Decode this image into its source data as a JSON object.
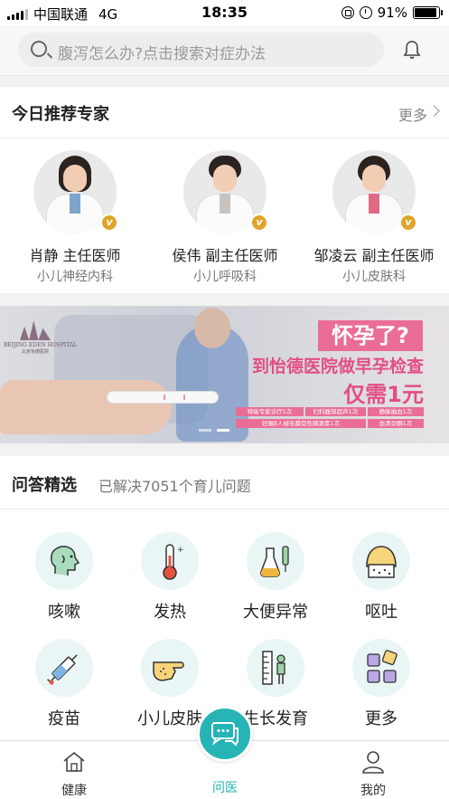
{
  "status_bar": {
    "carrier": "中国联通",
    "network": "4G",
    "time": "18:35",
    "battery": "91%"
  },
  "search": {
    "placeholder": "腹泻怎么办?点击搜索对症办法",
    "icon": "search-icon",
    "bell_icon": "bell-icon"
  },
  "experts": {
    "title": "今日推荐专家",
    "more": "更多",
    "badge": "v",
    "items": [
      {
        "name": "肖静 主任医师",
        "dept": "小儿神经内科"
      },
      {
        "name": "侯伟 副主任医师",
        "dept": "小儿呼吸科"
      },
      {
        "name": "邹凌云 副主任医师",
        "dept": "小儿皮肤科"
      }
    ]
  },
  "banner": {
    "logo_text": "BEIJING EDEN HOSPITAL",
    "logo_sub": "北京怡德医院",
    "headline": "怀孕了?",
    "line2": "到怡德医院做早孕检查",
    "line3": "仅需1元",
    "tags": [
      "特级专家诊疗1次",
      "妇科腹部超声1次",
      "静脉抽血1次",
      "妊娠β人绒毛膜促性腺激素1次",
      "血清孕酮1次"
    ],
    "active_slide": 2
  },
  "qa": {
    "title": "问答精选",
    "subtitle": "已解决7051个育儿问题",
    "categories": [
      {
        "label": "咳嗽",
        "icon": "cough-icon"
      },
      {
        "label": "发热",
        "icon": "thermometer-icon"
      },
      {
        "label": "大便异常",
        "icon": "flask-icon"
      },
      {
        "label": "呕吐",
        "icon": "vomit-icon"
      },
      {
        "label": "疫苗",
        "icon": "syringe-icon"
      },
      {
        "label": "小儿皮肤",
        "icon": "hand-icon"
      },
      {
        "label": "生长发育",
        "icon": "growth-icon"
      },
      {
        "label": "更多",
        "icon": "grid-icon"
      }
    ]
  },
  "tabbar": {
    "tabs": [
      {
        "label": "健康",
        "icon": "home-icon"
      },
      {
        "label": "问医",
        "icon": "chat-icon"
      },
      {
        "label": "我的",
        "icon": "user-icon"
      }
    ],
    "active_index": 1
  },
  "colors": {
    "accent": "#27b4b5",
    "banner_pink": "#e96d96",
    "badge_gold": "#e0a42a"
  }
}
